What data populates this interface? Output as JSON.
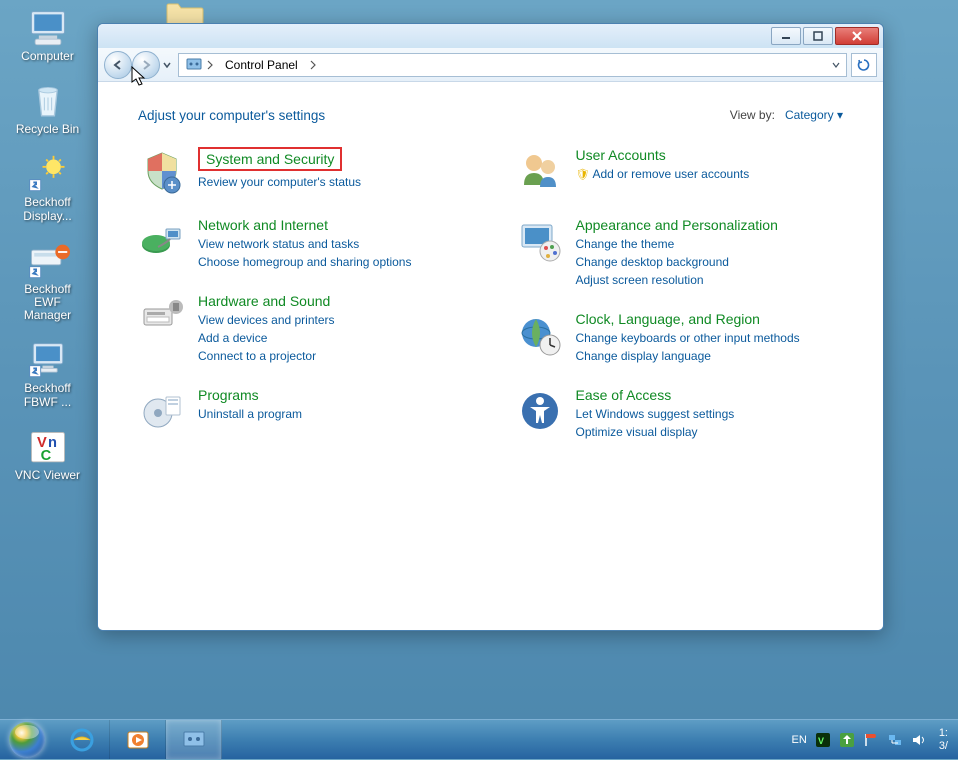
{
  "desktop_icons": [
    {
      "label": "Computer"
    },
    {
      "label": "Recycle Bin"
    },
    {
      "label": "Beckhoff Display..."
    },
    {
      "label": "Beckhoff EWF Manager"
    },
    {
      "label": "Beckhoff FBWF ..."
    },
    {
      "label": "VNC Viewer"
    }
  ],
  "window": {
    "breadcrumb_root": "Control Panel",
    "heading": "Adjust your computer's settings",
    "viewby_label": "View by:",
    "viewby_value": "Category",
    "categories_left": [
      {
        "title": "System and Security",
        "highlighted": true,
        "links": [
          "Review your computer's status"
        ]
      },
      {
        "title": "Network and Internet",
        "links": [
          "View network status and tasks",
          "Choose homegroup and sharing options"
        ]
      },
      {
        "title": "Hardware and Sound",
        "links": [
          "View devices and printers",
          "Add a device",
          "Connect to a projector"
        ]
      },
      {
        "title": "Programs",
        "links": [
          "Uninstall a program"
        ]
      }
    ],
    "categories_right": [
      {
        "title": "User Accounts",
        "links": [
          {
            "text": "Add or remove user accounts",
            "shield": true
          }
        ]
      },
      {
        "title": "Appearance and Personalization",
        "links": [
          "Change the theme",
          "Change desktop background",
          "Adjust screen resolution"
        ]
      },
      {
        "title": "Clock, Language, and Region",
        "links": [
          "Change keyboards or other input methods",
          "Change display language"
        ]
      },
      {
        "title": "Ease of Access",
        "links": [
          "Let Windows suggest settings",
          "Optimize visual display"
        ]
      }
    ]
  },
  "taskbar": {
    "lang": "EN",
    "time": "1:",
    "date": "3/"
  }
}
